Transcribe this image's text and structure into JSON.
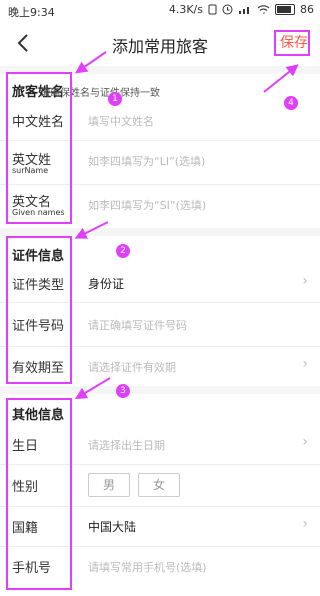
{
  "status_bar": {
    "time": "晚上9:34",
    "speed": "4.3K/s",
    "battery": "86",
    "battery_level": 0.86
  },
  "nav": {
    "title": "添加常用旅客",
    "save": "保存"
  },
  "sec1": {
    "title": "旅客姓名",
    "hint": "请确保姓名与证件保持一致",
    "cn_label": "中文姓名",
    "cn_ph": "填写中文姓名",
    "surname_label": "英文姓",
    "surname_sub": "surName",
    "surname_ph": "如李四填写为“LI”(选填)",
    "given_label": "英文名",
    "given_sub": "Given names",
    "given_ph": "如李四填写为“SI”(选填)"
  },
  "sec2": {
    "title": "证件信息",
    "type_label": "证件类型",
    "type_value": "身份证",
    "no_label": "证件号码",
    "no_ph": "请正确填写证件号码",
    "exp_label": "有效期至",
    "exp_ph": "请选择证件有效期"
  },
  "sec3": {
    "title": "其他信息",
    "bday_label": "生日",
    "bday_ph": "请选择出生日期",
    "gender_label": "性别",
    "male": "男",
    "female": "女",
    "nat_label": "国籍",
    "nat_value": "中国大陆",
    "phone_label": "手机号",
    "phone_ph": "请填写常用手机号(选填)"
  },
  "badges": {
    "b1": "1",
    "b2": "2",
    "b3": "3",
    "b4": "4"
  },
  "icons": {
    "back": "chevron-left-icon",
    "chevron": "chevron-right-icon"
  },
  "colors": {
    "save": "#ff5a45",
    "annotation": "#e040fb"
  }
}
